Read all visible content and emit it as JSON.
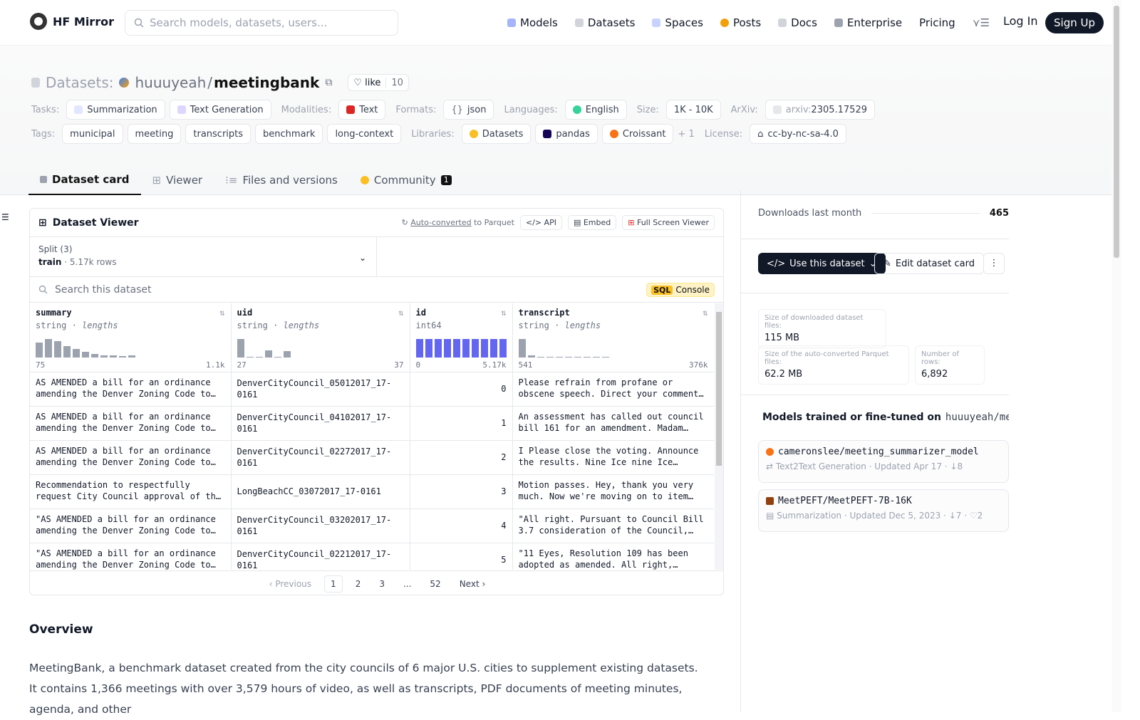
{
  "nav": {
    "brand": "HF Mirror",
    "search_placeholder": "Search models, datasets, users...",
    "links": [
      "Models",
      "Datasets",
      "Spaces",
      "Posts",
      "Docs",
      "Enterprise",
      "Pricing"
    ],
    "login": "Log In",
    "signup": "Sign Up"
  },
  "header": {
    "section_label": "Datasets:",
    "owner": "huuuyeah",
    "slash": "/",
    "name": "meetingbank",
    "like_label": "like",
    "like_count": "10",
    "tasks_label": "Tasks:",
    "tasks": [
      "Summarization",
      "Text Generation"
    ],
    "modalities_label": "Modalities:",
    "modality": "Text",
    "formats_label": "Formats:",
    "format": "json",
    "languages_label": "Languages:",
    "language": "English",
    "size_label": "Size:",
    "size": "1K - 10K",
    "arxiv_label": "ArXiv:",
    "arxiv_prefix": "arxiv:",
    "arxiv": "2305.17529",
    "tags_label": "Tags:",
    "tags": [
      "municipal",
      "meeting",
      "transcripts",
      "benchmark",
      "long-context"
    ],
    "libraries_label": "Libraries:",
    "libraries": [
      "Datasets",
      "pandas",
      "Croissant"
    ],
    "libraries_more": "+ 1",
    "license_label": "License:",
    "license": "cc-by-nc-sa-4.0"
  },
  "tabs": [
    {
      "label": "Dataset card"
    },
    {
      "label": "Viewer"
    },
    {
      "label": "Files and versions"
    },
    {
      "label": "Community",
      "badge": "1"
    }
  ],
  "viewer": {
    "title": "Dataset Viewer",
    "autoconv": "Auto-converted",
    "to_parquet": "to Parquet",
    "api": "API",
    "embed": "Embed",
    "fullscreen": "Full Screen Viewer",
    "split_label": "Split (3)",
    "split_name": "train",
    "split_rows": "5.17k rows",
    "search_placeholder": "Search this dataset",
    "sql_tag": "SQL",
    "sql_label": "Console",
    "columns": [
      {
        "name": "summary",
        "type": "string",
        "sub": "lengths",
        "min": "75",
        "max": "1.1k",
        "hist": [
          0.8,
          1.0,
          0.9,
          0.6,
          0.45,
          0.3,
          0.2,
          0.12,
          0.1,
          0.08,
          0.12
        ]
      },
      {
        "name": "uid",
        "type": "string",
        "sub": "lengths",
        "min": "27",
        "max": "37",
        "hist": [
          1.0,
          0,
          0.05,
          0.4,
          0,
          0.35
        ]
      },
      {
        "name": "id",
        "type": "int64",
        "sub": "",
        "min": "0",
        "max": "5.17k",
        "hist": [
          1,
          1,
          1,
          1,
          1,
          1,
          1,
          1,
          1,
          1
        ]
      },
      {
        "name": "transcript",
        "type": "string",
        "sub": "lengths",
        "min": "541",
        "max": "376k",
        "hist": [
          1.0,
          0.1,
          0.05,
          0.05,
          0.05,
          0.05,
          0.04,
          0.04,
          0.03,
          0.03
        ]
      }
    ],
    "rows": [
      {
        "summary": "AS AMENDED a bill for an ordinance amending the Denver Zoning Code to…",
        "uid": "DenverCityCouncil_05012017_17-0161",
        "id": "0",
        "transcript": "Please refrain from profane or obscene speech. Direct your comments to…"
      },
      {
        "summary": "AS AMENDED a bill for an ordinance amending the Denver Zoning Code to…",
        "uid": "DenverCityCouncil_04102017_17-0161",
        "id": "1",
        "transcript": "An assessment has called out council bill 161 for an amendment. Madam…"
      },
      {
        "summary": "AS AMENDED a bill for an ordinance amending the Denver Zoning Code to…",
        "uid": "DenverCityCouncil_02272017_17-0161",
        "id": "2",
        "transcript": "I Please close the voting. Announce the results. Nine Ice nine Ice Counci…"
      },
      {
        "summary": "Recommendation to respectfully request City Council approval of the 2017…",
        "uid": "LongBeachCC_03072017_17-0161",
        "id": "3",
        "transcript": "Motion passes. Hey, thank you very much. Now we're moving on to item 22.…"
      },
      {
        "summary": "\"AS AMENDED a bill for an ordinance amending the Denver Zoning Code to…",
        "uid": "DenverCityCouncil_03202017_17-0161",
        "id": "4",
        "transcript": "\"All right. Pursuant to Council Bill 3.7 consideration of the Council, Bil…"
      },
      {
        "summary": "\"AS AMENDED a bill for an ordinance amending the Denver Zoning Code to…",
        "uid": "DenverCityCouncil_02212017_17-0161",
        "id": "5",
        "transcript": "\"11 Eyes, Resolution 109 has been adopted as amended. All right, Madam…"
      }
    ],
    "pager": {
      "prev": "Previous",
      "pages": [
        "1",
        "2",
        "3",
        "...",
        "52"
      ],
      "next": "Next"
    }
  },
  "overview": {
    "title": "Overview",
    "text": "MeetingBank, a benchmark dataset created from the city councils of 6 major U.S. cities to supplement existing datasets. It contains 1,366 meetings with over 3,579 hours of video, as well as transcripts, PDF documents of meeting minutes, agenda, and other"
  },
  "sidebar": {
    "downloads_label": "Downloads last month",
    "downloads": "465",
    "use_button": "Use this dataset",
    "edit_button": "Edit dataset card",
    "stats": [
      {
        "k": "Size of downloaded dataset files:",
        "v": "115 MB"
      },
      {
        "k": "Size of the auto-converted Parquet files:",
        "v": "62.2 MB"
      },
      {
        "k": "Number of rows:",
        "v": "6,892"
      }
    ],
    "models_head": "Models trained or fine-tuned on",
    "models_ds": "huuuyeah/meeti…",
    "models": [
      {
        "name": "cameronslee/meeting_summarizer_model",
        "task": "Text2Text Generation",
        "updated": "Updated Apr 17",
        "downloads": "8",
        "likes": ""
      },
      {
        "name": "MeetPEFT/MeetPEFT-7B-16K",
        "task": "Summarization",
        "updated": "Updated Dec 5, 2023",
        "downloads": "7",
        "likes": "2"
      }
    ]
  },
  "colors": {
    "accent": "#111827",
    "histogram": "#9ca3af",
    "histogram_int": "#6366f1",
    "sql": "#fbbf24"
  }
}
